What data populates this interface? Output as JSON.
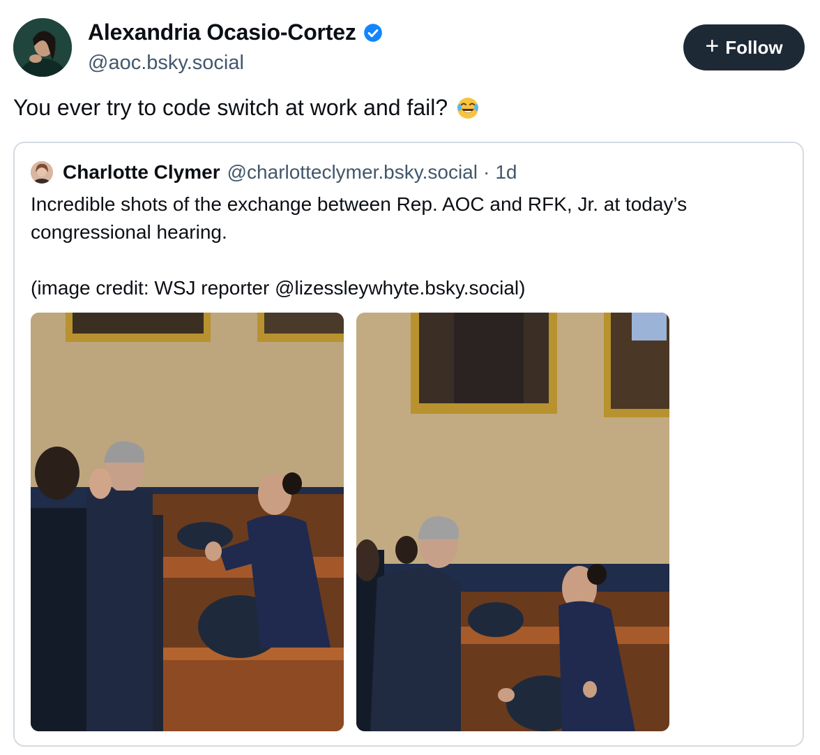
{
  "author": {
    "display_name": "Alexandria Ocasio-Cortez",
    "handle": "@aoc.bsky.social",
    "verified_icon": "verified-badge-icon",
    "avatar_icon": "avatar"
  },
  "follow_button": {
    "label": "Follow",
    "icon": "plus-icon"
  },
  "post": {
    "text": "You ever try to code switch at work and fail?",
    "emoji": "face-with-tears-of-joy-icon"
  },
  "quoted_post": {
    "author_name": "Charlotte Clymer",
    "author_handle": "@charlotteclymer.bsky.social",
    "separator": "·",
    "time": "1d",
    "text": "Incredible shots of the exchange between Rep. AOC and RFK, Jr. at today’s congressional hearing.\n\n(image credit: WSJ reporter @lizessleywhyte.bsky.social)",
    "images": [
      "photo-hearing-1",
      "photo-hearing-2"
    ]
  },
  "colors": {
    "follow_bg": "#1e2936",
    "handle_text": "#42576c",
    "border": "#d4dbe2",
    "verified": "#1185fe"
  }
}
